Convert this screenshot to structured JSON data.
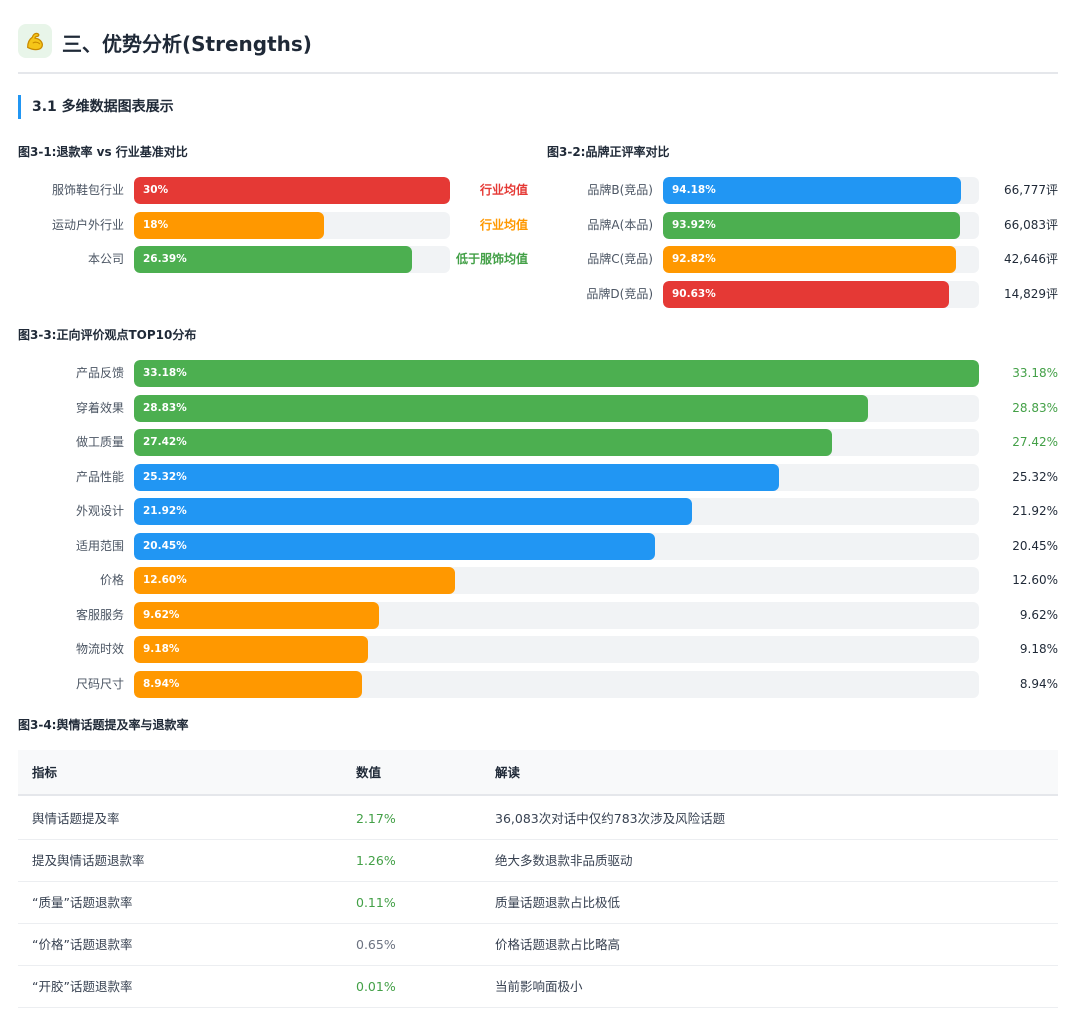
{
  "header": {
    "title": "三、优势分析(Strengths)",
    "icon": "flexed-biceps-icon"
  },
  "section": {
    "title": "3.1 多维数据图表展示"
  },
  "colors": {
    "red": "#e53935",
    "orange": "#ff9800",
    "green": "#4caf50",
    "blue": "#2196f3",
    "track": "#f1f3f5"
  },
  "chart_data": [
    {
      "type": "bar",
      "title": "图3-1:退款率 vs 行业基准对比",
      "orientation": "horizontal",
      "xlim": [
        0,
        30
      ],
      "categories": [
        "服饰鞋包行业",
        "运动户外行业",
        "本公司"
      ],
      "values": [
        30,
        18,
        26.39
      ],
      "value_labels": [
        "30%",
        "18%",
        "26.39%"
      ],
      "notes": [
        "行业均值",
        "行业均值",
        "低于服饰均值"
      ],
      "bar_colors": [
        "#e53935",
        "#ff9800",
        "#4caf50"
      ],
      "note_colors": [
        "#e53935",
        "#ff9800",
        "#43a047"
      ]
    },
    {
      "type": "bar",
      "title": "图3-2:品牌正评率对比",
      "orientation": "horizontal",
      "xlim": [
        0,
        100
      ],
      "categories": [
        "品牌B(竞品)",
        "品牌A(本品)",
        "品牌C(竞品)",
        "品牌D(竞品)"
      ],
      "values": [
        94.18,
        93.92,
        92.82,
        90.63
      ],
      "value_labels": [
        "94.18%",
        "93.92%",
        "92.82%",
        "90.63%"
      ],
      "notes": [
        "66,777评",
        "66,083评",
        "42,646评",
        "14,829评"
      ],
      "bar_colors": [
        "#2196f3",
        "#4caf50",
        "#ff9800",
        "#e53935"
      ],
      "note_colors": [
        "#1f2937",
        "#1f2937",
        "#1f2937",
        "#1f2937"
      ]
    },
    {
      "type": "bar",
      "title": "图3-3:正向评价观点TOP10分布",
      "orientation": "horizontal",
      "xlim": [
        0,
        33.18
      ],
      "categories": [
        "产品反馈",
        "穿着效果",
        "做工质量",
        "产品性能",
        "外观设计",
        "适用范围",
        "价格",
        "客服服务",
        "物流时效",
        "尺码尺寸"
      ],
      "values": [
        33.18,
        28.83,
        27.42,
        25.32,
        21.92,
        20.45,
        12.6,
        9.62,
        9.18,
        8.94
      ],
      "value_labels": [
        "33.18%",
        "28.83%",
        "27.42%",
        "25.32%",
        "21.92%",
        "20.45%",
        "12.60%",
        "9.62%",
        "9.18%",
        "8.94%"
      ],
      "notes": [
        "33.18%",
        "28.83%",
        "27.42%",
        "25.32%",
        "21.92%",
        "20.45%",
        "12.60%",
        "9.62%",
        "9.18%",
        "8.94%"
      ],
      "bar_colors": [
        "#4caf50",
        "#4caf50",
        "#4caf50",
        "#2196f3",
        "#2196f3",
        "#2196f3",
        "#ff9800",
        "#ff9800",
        "#ff9800",
        "#ff9800"
      ],
      "note_colors": [
        "#43a047",
        "#43a047",
        "#43a047",
        "#1f2937",
        "#1f2937",
        "#1f2937",
        "#1f2937",
        "#1f2937",
        "#1f2937",
        "#1f2937"
      ]
    },
    {
      "type": "table",
      "title": "图3-4:舆情话题提及率与退款率",
      "columns": [
        "指标",
        "数值",
        "解读"
      ],
      "rows": [
        {
          "metric": "舆情话题提及率",
          "value": "2.17%",
          "note": "36,083次对话中仅约783次涉及风险话题",
          "value_color": "#43a047"
        },
        {
          "metric": "提及舆情话题退款率",
          "value": "1.26%",
          "note": "绝大多数退款非品质驱动",
          "value_color": "#43a047"
        },
        {
          "metric": "“质量”话题退款率",
          "value": "0.11%",
          "note": "质量话题退款占比极低",
          "value_color": "#43a047"
        },
        {
          "metric": "“价格”话题退款率",
          "value": "0.65%",
          "note": "价格话题退款占比略高",
          "value_color": "#6b7280"
        },
        {
          "metric": "“开胶”话题退款率",
          "value": "0.01%",
          "note": "当前影响面极小",
          "value_color": "#43a047"
        }
      ]
    }
  ]
}
